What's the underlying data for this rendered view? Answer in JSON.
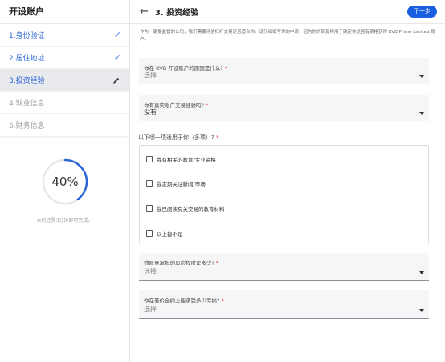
{
  "sidebar": {
    "title": "开设账户",
    "steps": [
      {
        "label": "1.身份验证",
        "state": "done",
        "icon": "check-icon",
        "icon_glyph": "✓"
      },
      {
        "label": "2.居住地址",
        "state": "done",
        "icon": "check-icon",
        "icon_glyph": "✓"
      },
      {
        "label": "3.投资经验",
        "state": "current",
        "icon": "edit-pencil-icon"
      },
      {
        "label": "4.就业信息",
        "state": "todo"
      },
      {
        "label": "5.财务信息",
        "state": "todo"
      }
    ],
    "progress": {
      "percent_text": "40%",
      "value": 0.4,
      "note": "大约还需3分钟即可完成。"
    }
  },
  "header": {
    "back_icon": "arrow-left-icon",
    "back_glyph": "←",
    "title": "3. 投资经验",
    "next_label": "下一步"
  },
  "intro": "作为一家受监管的公司，我们需要评估杠杆交易是否适合你。请仔细填写你的申请，因为你的回复将用于确定你是否有资格获得 KVB Prime Limited 账户。",
  "fields": [
    {
      "label": "你在 KVB 开设账户的原因是什么?",
      "required_mark": "*",
      "value": "选择",
      "is_placeholder": true
    },
    {
      "label": "你有真实账户交易经验吗?",
      "required_mark": "*",
      "value": "没有",
      "is_placeholder": false
    }
  ],
  "multi": {
    "label": "以下哪一项适用于你（多项）?",
    "required_mark": "*",
    "options": [
      {
        "label": "我有相关的教育/专业资格",
        "checked": false
      },
      {
        "label": "我定期关注新闻/市场",
        "checked": false
      },
      {
        "label": "我已阅读有关交易的教育材料",
        "checked": false
      },
      {
        "label": "以上都不是",
        "checked": false
      }
    ]
  },
  "fields_lower": [
    {
      "label": "你愿意承担的风险程度是多少?",
      "required_mark": "*",
      "value": "选择",
      "is_placeholder": true
    },
    {
      "label": "你在差价合约上能承受多少亏损?",
      "required_mark": "*",
      "value": "选择",
      "is_placeholder": true
    }
  ],
  "colors": {
    "accent": "#1a5fe0",
    "link": "#2b66d9",
    "required": "#e33333"
  }
}
